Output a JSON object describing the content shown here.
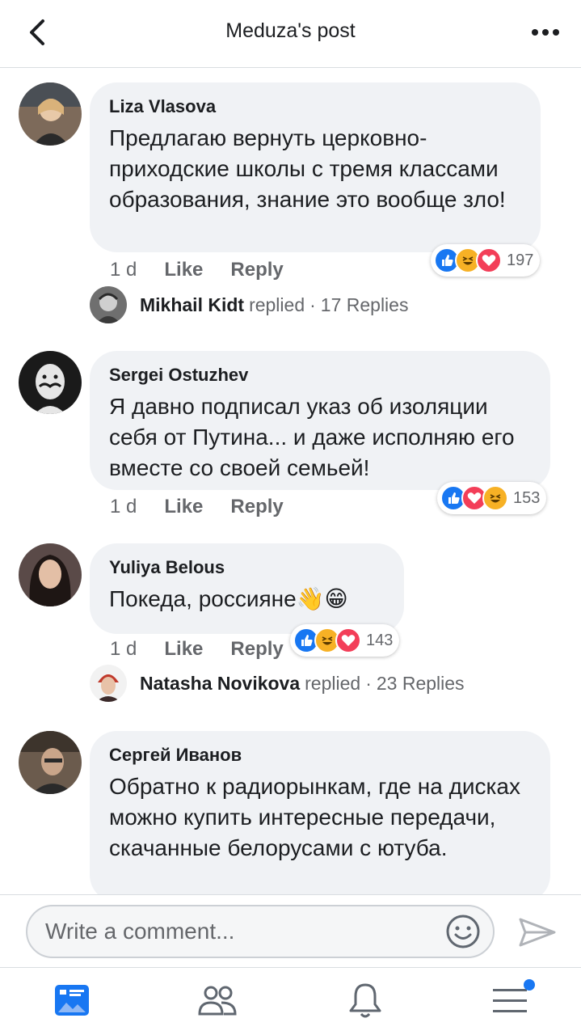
{
  "header": {
    "title": "Meduza's post",
    "back_icon": "chevron-left-icon",
    "more_icon": "more-dots-icon"
  },
  "comments": [
    {
      "author": "Liza Vlasova",
      "text": "Предлагаю вернуть церковно-приходские школы с тремя классами образования, знание это вообще зло!",
      "time": "1 d",
      "like_label": "Like",
      "reply_label": "Reply",
      "reactions": [
        "like",
        "haha",
        "love"
      ],
      "reaction_count": "197",
      "replies": {
        "name": "Mikhail  Kidt",
        "verb": "replied",
        "separator": "·",
        "count": "17 Replies"
      }
    },
    {
      "author": "Sergei Ostuzhev",
      "text": "Я давно подписал указ об изоляции себя от Путина... и даже исполняю его вместе со своей семьей!",
      "time": "1 d",
      "like_label": "Like",
      "reply_label": "Reply",
      "reactions": [
        "like",
        "love",
        "haha"
      ],
      "reaction_count": "153"
    },
    {
      "author": "Yuliya Belous",
      "text": "Покеда, россияне",
      "text_emoji": "👋😁",
      "time": "1 d",
      "like_label": "Like",
      "reply_label": "Reply",
      "reactions": [
        "like",
        "haha",
        "love"
      ],
      "reaction_count": "143",
      "replies": {
        "name": "Natasha Novikova",
        "verb": "replied",
        "separator": "·",
        "count": "23 Replies"
      }
    },
    {
      "author": "Сергей Иванов",
      "text": "Обратно к радиорынкам, где на дисках можно купить интересные передачи, скачанные белорусами с ютуба."
    }
  ],
  "composer": {
    "placeholder": "Write a comment...",
    "emoji_icon": "smiley-icon",
    "send_icon": "send-icon"
  },
  "tabbar": {
    "tabs": [
      "news-feed-icon",
      "friends-icon",
      "notifications-bell-icon",
      "menu-icon"
    ],
    "active_tab": "news-feed-icon",
    "accent": "#1877f2"
  },
  "colors": {
    "bubble": "#f0f2f5",
    "like": "#1877f2",
    "love": "#f33e58",
    "haha": "#f7b125"
  }
}
